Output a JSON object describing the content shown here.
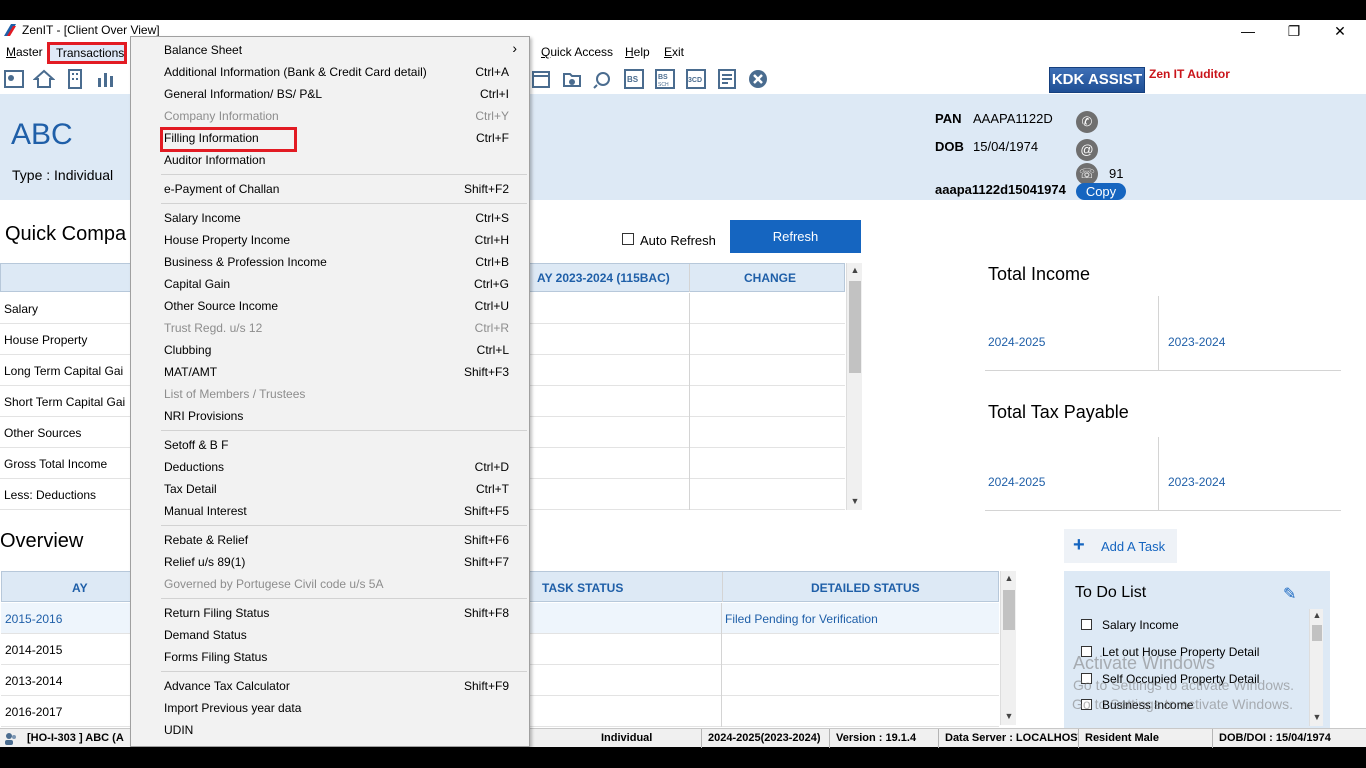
{
  "window": {
    "title": "ZenIT - [Client Over View]"
  },
  "menubar": [
    {
      "label": "Master",
      "underline": "M",
      "rest": "aster"
    },
    {
      "label": "Transactions",
      "underline": "T",
      "rest": "ransactions"
    },
    {
      "label": "Quick Access",
      "underline": "Q",
      "rest": "uick Access"
    },
    {
      "label": "Help",
      "underline": "H",
      "rest": "elp"
    },
    {
      "label": "Exit",
      "underline": "E",
      "rest": "xit"
    }
  ],
  "toolbar": {
    "kdk_assist": "KDK ASSIST",
    "zen_auditor": "Zen IT Auditor"
  },
  "client": {
    "name": "ABC",
    "type": "Type : Individual",
    "pan_label": "PAN",
    "pan": "AAAPA1122D",
    "dob_label": "DOB",
    "dob": "15/04/1974",
    "phone_count": "91",
    "login_id": "aaapa1122d15041974",
    "copy": "Copy"
  },
  "quick_comparison": {
    "title": "Quick Compa",
    "auto_refresh": "Auto Refresh",
    "refresh": "Refresh",
    "col_ay": "AY 2023-2024 (115BAC)",
    "col_change": "CHANGE",
    "rows": [
      "Salary",
      "House Property",
      "Long Term Capital Gai",
      "Short Term Capital Gai",
      "Other Sources",
      "Gross Total Income",
      "Less: Deductions"
    ]
  },
  "totals": {
    "income_title": "Total Income",
    "tax_title": "Total Tax Payable",
    "year1": "2024-2025",
    "year2": "2023-2024"
  },
  "overview": {
    "title": "Overview",
    "col_ay": "AY",
    "col_task_status": "TASK STATUS",
    "col_detailed_status": "DETAILED STATUS",
    "rows": [
      {
        "ay": "2015-2016",
        "detailed": "Filed Pending for Verification"
      },
      {
        "ay": "2014-2015",
        "detailed": ""
      },
      {
        "ay": "2013-2014",
        "detailed": ""
      },
      {
        "ay": "2016-2017",
        "detailed": ""
      }
    ]
  },
  "tasks": {
    "add_task": "Add A Task",
    "todo_title": "To Do List",
    "items": [
      "Salary Income",
      "Let out House Property Detail",
      "Self Occupied Property Detail",
      "Business Income"
    ]
  },
  "watermark": {
    "line1": "Activate Windows",
    "line2": "Go to Settings to activate Windows.",
    "line3": "Go to Settings to activate Windows."
  },
  "statusbar": {
    "client": "[HO-I-303 ] ABC (A",
    "type": "Individual",
    "year": "2024-2025(2023-2024)",
    "version": "Version : 19.1.4",
    "server": "Data Server : LOCALHOST",
    "residency": "Resident Male",
    "dob": "DOB/DOI : 15/04/1974"
  },
  "dropdown": {
    "items": [
      {
        "label": "Balance Sheet",
        "shortcut": "›",
        "disabled": false
      },
      {
        "label": "Additional Information (Bank & Credit Card detail)",
        "shortcut": "Ctrl+A",
        "disabled": false
      },
      {
        "label": "General Information/ BS/ P&L",
        "shortcut": "Ctrl+I",
        "disabled": false
      },
      {
        "label": "Company Information",
        "shortcut": "Ctrl+Y",
        "disabled": true
      },
      {
        "label": "Filling Information",
        "shortcut": "Ctrl+F",
        "disabled": false
      },
      {
        "label": "Auditor Information",
        "shortcut": "",
        "disabled": false
      },
      {
        "label": "e-Payment of Challan",
        "shortcut": "Shift+F2",
        "disabled": false
      },
      {
        "label": "Salary Income",
        "shortcut": "Ctrl+S",
        "disabled": false
      },
      {
        "label": "House Property Income",
        "shortcut": "Ctrl+H",
        "disabled": false
      },
      {
        "label": "Business & Profession Income",
        "shortcut": "Ctrl+B",
        "disabled": false
      },
      {
        "label": "Capital Gain",
        "shortcut": "Ctrl+G",
        "disabled": false
      },
      {
        "label": "Other Source Income",
        "shortcut": "Ctrl+U",
        "disabled": false
      },
      {
        "label": "Trust Regd. u/s 12",
        "shortcut": "Ctrl+R",
        "disabled": true
      },
      {
        "label": "Clubbing",
        "shortcut": "Ctrl+L",
        "disabled": false
      },
      {
        "label": "MAT/AMT",
        "shortcut": "Shift+F3",
        "disabled": false
      },
      {
        "label": "List of Members / Trustees",
        "shortcut": "",
        "disabled": true
      },
      {
        "label": "NRI Provisions",
        "shortcut": "",
        "disabled": false
      },
      {
        "label": "Setoff & B F",
        "shortcut": "",
        "disabled": false
      },
      {
        "label": "Deductions",
        "shortcut": "Ctrl+D",
        "disabled": false
      },
      {
        "label": "Tax Detail",
        "shortcut": "Ctrl+T",
        "disabled": false
      },
      {
        "label": "Manual Interest",
        "shortcut": "Shift+F5",
        "disabled": false
      },
      {
        "label": "Rebate & Relief",
        "shortcut": "Shift+F6",
        "disabled": false
      },
      {
        "label": "Relief u/s 89(1)",
        "shortcut": "Shift+F7",
        "disabled": false
      },
      {
        "label": "Governed by Portugese Civil code u/s 5A",
        "shortcut": "",
        "disabled": true
      },
      {
        "label": "Return Filing Status",
        "shortcut": "Shift+F8",
        "disabled": false
      },
      {
        "label": "Demand Status",
        "shortcut": "",
        "disabled": false
      },
      {
        "label": "Forms Filing Status",
        "shortcut": "",
        "disabled": false
      },
      {
        "label": "Advance Tax Calculator",
        "shortcut": "Shift+F9",
        "disabled": false
      },
      {
        "label": "Import Previous year data",
        "shortcut": "",
        "disabled": false
      },
      {
        "label": "UDIN",
        "shortcut": "",
        "disabled": false
      }
    ]
  },
  "colors": {
    "accent": "#1565c0",
    "header_bg": "#dde9f5",
    "highlight": "#e21b23"
  }
}
